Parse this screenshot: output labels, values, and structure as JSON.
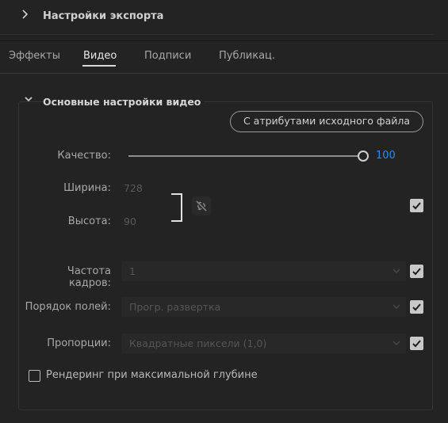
{
  "header": {
    "title": "Настройки экспорта"
  },
  "tabs": [
    {
      "label": "Эффекты"
    },
    {
      "label": "Видео"
    },
    {
      "label": "Подписи"
    },
    {
      "label": "Публикац."
    }
  ],
  "section": {
    "title": "Основные настройки видео",
    "match_source_label": "С атрибутами исходного файла",
    "quality": {
      "label": "Качество:",
      "value": "100"
    },
    "width": {
      "label": "Ширина:",
      "value": "728"
    },
    "height": {
      "label": "Высота:",
      "value": "90"
    },
    "frame_rate": {
      "label": "Частота кадров:",
      "value": "1"
    },
    "field_order": {
      "label": "Порядок полей:",
      "value": "Прогр. развертка"
    },
    "aspect": {
      "label": "Пропорции:",
      "value": "Квадратные пиксели (1,0)"
    },
    "max_depth": {
      "label": "Рендеринг при максимальной глубине",
      "checked": false
    },
    "dimensions_checked": true,
    "frame_rate_checked": true,
    "field_order_checked": true,
    "aspect_checked": true
  },
  "colors": {
    "accent_value": "#2d8ceb",
    "background": "#232323"
  },
  "icons": {
    "expand": "chevron-right-icon",
    "collapse": "chevron-down-icon",
    "link": "unlink-icon",
    "check": "checkmark-icon"
  }
}
